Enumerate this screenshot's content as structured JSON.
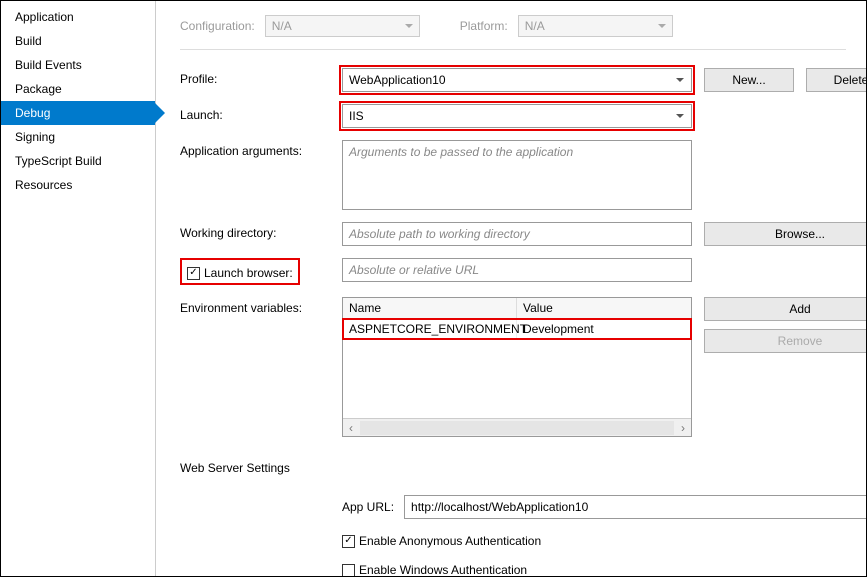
{
  "sidebar": {
    "items": [
      {
        "label": "Application"
      },
      {
        "label": "Build"
      },
      {
        "label": "Build Events"
      },
      {
        "label": "Package"
      },
      {
        "label": "Debug",
        "selected": true
      },
      {
        "label": "Signing"
      },
      {
        "label": "TypeScript Build"
      },
      {
        "label": "Resources"
      }
    ]
  },
  "top": {
    "config_label": "Configuration:",
    "config_value": "N/A",
    "platform_label": "Platform:",
    "platform_value": "N/A"
  },
  "labels": {
    "profile": "Profile:",
    "launch": "Launch:",
    "app_args": "Application arguments:",
    "working_dir": "Working directory:",
    "launch_browser": "Launch browser:",
    "env_vars": "Environment variables:",
    "web_server": "Web Server Settings",
    "app_url": "App URL:",
    "enable_anon": "Enable Anonymous Authentication",
    "enable_win": "Enable Windows Authentication"
  },
  "values": {
    "profile": "WebApplication10",
    "launch": "IIS",
    "app_url": "http://localhost/WebApplication10",
    "launch_browser_checked": true,
    "anon_checked": true,
    "win_checked": false
  },
  "placeholders": {
    "app_args": "Arguments to be passed to the application",
    "working_dir": "Absolute path to working directory",
    "launch_url": "Absolute or relative URL"
  },
  "buttons": {
    "new": "New...",
    "delete": "Delete",
    "browse": "Browse...",
    "add": "Add",
    "remove": "Remove"
  },
  "env": {
    "columns": {
      "name": "Name",
      "value": "Value"
    },
    "rows": [
      {
        "name": "ASPNETCORE_ENVIRONMENT",
        "value": "Development"
      }
    ]
  }
}
